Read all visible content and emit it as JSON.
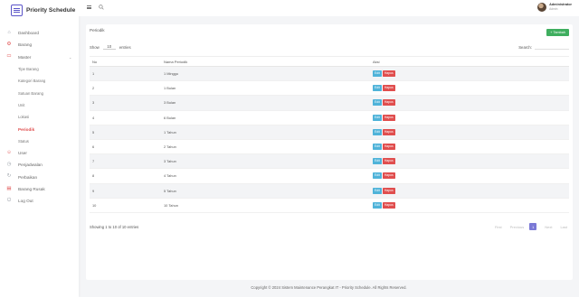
{
  "app": {
    "name": "Priority Schedule"
  },
  "user": {
    "name": "Administrator",
    "role": "Admin"
  },
  "sidebar": {
    "items": [
      {
        "label": "Dashboard",
        "icon": "home-icon"
      },
      {
        "label": "Barang",
        "icon": "gear-icon"
      },
      {
        "label": "Master",
        "icon": "folder-icon"
      }
    ],
    "master_sub": [
      "Tipe Barang",
      "Kategori Barang",
      "Satuan Barang",
      "Unit",
      "Lokasi",
      "Periodik",
      "Status"
    ],
    "items_after": [
      {
        "label": "User",
        "icon": "user-icon"
      },
      {
        "label": "Penjadwalan",
        "icon": "clock-icon"
      },
      {
        "label": "Perbaikan",
        "icon": "wrench-icon"
      },
      {
        "label": "Barang Rusak",
        "icon": "box-icon"
      },
      {
        "label": "Log Out",
        "icon": "power-icon"
      }
    ]
  },
  "page": {
    "title": "Periodik",
    "add_label": "+ Tambah",
    "show_label": "Show",
    "entries_value": "10",
    "entries_label": "entries",
    "search_label": "Search:",
    "search_value": ""
  },
  "table": {
    "headers": [
      "No",
      "Nama Periodik",
      "Aksi"
    ],
    "edit_label": "Edit",
    "delete_label": "Hapus",
    "rows": [
      {
        "no": "1",
        "nama": "1 Minggu"
      },
      {
        "no": "2",
        "nama": "1 Bulan"
      },
      {
        "no": "3",
        "nama": "3 Bulan"
      },
      {
        "no": "4",
        "nama": "6 Bulan"
      },
      {
        "no": "5",
        "nama": "1 Tahun"
      },
      {
        "no": "6",
        "nama": "2 Tahun"
      },
      {
        "no": "7",
        "nama": "3 Tahun"
      },
      {
        "no": "8",
        "nama": "4 Tahun"
      },
      {
        "no": "9",
        "nama": "5 Tahun"
      },
      {
        "no": "10",
        "nama": "10 Tahun"
      }
    ]
  },
  "pagination": {
    "info": "Showing 1 to 10 of 10 entries",
    "first": "First",
    "previous": "Previous",
    "current": "1",
    "next": "Next",
    "last": "Last"
  },
  "footer": {
    "text": "Copyright © 2024 Sistem Maintenance Perangkat IT - Priority Schedule. All Rights Reserved."
  },
  "colors": {
    "accent": "#5a54c8",
    "active": "#e04e4e",
    "add": "#3fae5f",
    "edit": "#4fb3d9",
    "page": "#7b79d6"
  }
}
